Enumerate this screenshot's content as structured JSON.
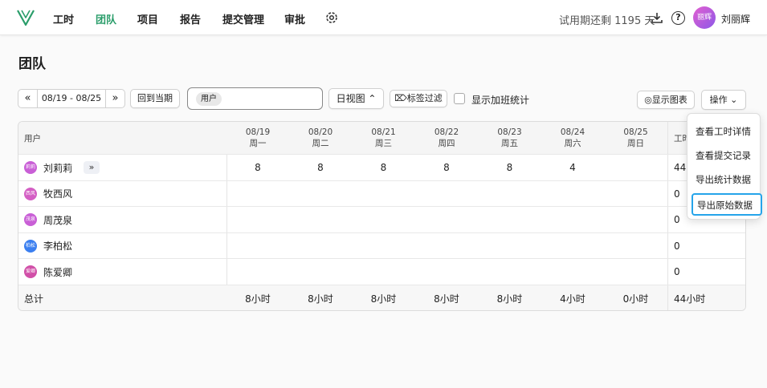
{
  "nav": {
    "items": [
      "工时",
      "团队",
      "项目",
      "报告",
      "提交管理",
      "审批"
    ],
    "active": "团队",
    "trial_text": "试用期还剩 1195 天",
    "user_avatar_text": "丽辉",
    "user_name": "刘丽辉"
  },
  "page_title": "团队",
  "toolbar": {
    "prev_label": "«",
    "date_range": "08/19 - 08/25",
    "next_label": "»",
    "current_period_label": "回到当期",
    "user_filter_tag": "用户",
    "view_label": "日视图 ⌃",
    "tag_filter_label": "标签过滤",
    "overtime_label": "显示加班统计",
    "chart_label": "显示图表",
    "actions_label": "操作"
  },
  "table": {
    "user_header": "用户",
    "hours_header": "工时",
    "days": [
      {
        "date": "08/19",
        "weekday": "周一"
      },
      {
        "date": "08/20",
        "weekday": "周二"
      },
      {
        "date": "08/21",
        "weekday": "周三"
      },
      {
        "date": "08/22",
        "weekday": "周四"
      },
      {
        "date": "08/23",
        "weekday": "周五"
      },
      {
        "date": "08/24",
        "weekday": "周六"
      },
      {
        "date": "08/25",
        "weekday": "周日"
      }
    ],
    "rows": [
      {
        "avatar": "莉莉",
        "avatar_color": "#c95fd6",
        "name": "刘莉莉",
        "values": [
          "8",
          "8",
          "8",
          "8",
          "8",
          "4",
          ""
        ],
        "total": "44",
        "expand": "»"
      },
      {
        "avatar": "西风",
        "avatar_color": "#d45fc4",
        "name": "牧西风",
        "values": [
          "",
          "",
          "",
          "",
          "",
          "",
          ""
        ],
        "total": "0"
      },
      {
        "avatar": "茂泉",
        "avatar_color": "#c95fd6",
        "name": "周茂泉",
        "values": [
          "",
          "",
          "",
          "",
          "",
          "",
          ""
        ],
        "total": "0"
      },
      {
        "avatar": "柏松",
        "avatar_color": "#3b7ff0",
        "name": "李柏松",
        "values": [
          "",
          "",
          "",
          "",
          "",
          "",
          ""
        ],
        "total": "0"
      },
      {
        "avatar": "爱卿",
        "avatar_color": "#d14fa8",
        "name": "陈爱卿",
        "values": [
          "",
          "",
          "",
          "",
          "",
          "",
          ""
        ],
        "total": "0"
      }
    ],
    "total_label": "总计",
    "totals": [
      "8小时",
      "8小时",
      "8小时",
      "8小时",
      "8小时",
      "4小时",
      "0小时"
    ],
    "grand_total": "44小时"
  },
  "menu": {
    "items": [
      "查看工时详情",
      "查看提交记录",
      "导出统计数据",
      "导出原始数据"
    ],
    "highlight_color": "#25a4ea"
  }
}
